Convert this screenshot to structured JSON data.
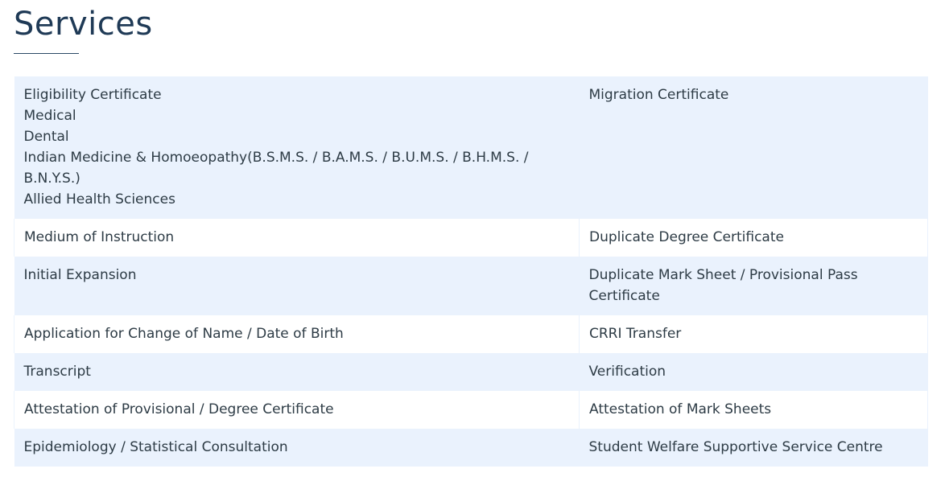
{
  "page": {
    "title": "Services"
  },
  "rows": [
    {
      "left": [
        "Eligibility Certificate",
        "Medical",
        "Dental",
        "Indian Medicine & Homoeopathy(B.S.M.S. / B.A.M.S. / B.U.M.S. / B.H.M.S. / B.N.Y.S.)",
        "Allied Health Sciences"
      ],
      "right": "Migration Certificate"
    },
    {
      "left": [
        "Medium of Instruction"
      ],
      "right": "Duplicate Degree Certificate"
    },
    {
      "left": [
        "Initial Expansion"
      ],
      "right": "Duplicate Mark Sheet / Provisional Pass Certificate"
    },
    {
      "left": [
        "Application for Change of Name / Date of Birth"
      ],
      "right": "CRRI Transfer"
    },
    {
      "left": [
        "Transcript"
      ],
      "right": "Verification"
    },
    {
      "left": [
        "Attestation of Provisional / Degree Certificate"
      ],
      "right": "Attestation of Mark Sheets"
    },
    {
      "left": [
        "Epidemiology / Statistical Consultation"
      ],
      "right": "Student Welfare Supportive Service Centre"
    }
  ]
}
